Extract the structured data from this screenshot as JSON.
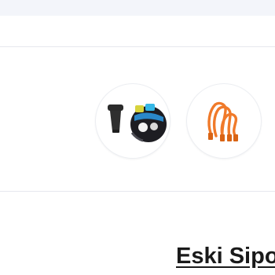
{
  "products": [
    {
      "id": "car-charger",
      "icon": "car-charger-icon"
    },
    {
      "id": "cable",
      "icon": "orange-cable-icon"
    }
  ],
  "section": {
    "title": "Eski Sipo"
  },
  "colors": {
    "top_band": "#f3f5fa",
    "divider": "#e6e8ee",
    "cable_orange": "#f07a2a",
    "title_text": "#1a1a1a"
  }
}
